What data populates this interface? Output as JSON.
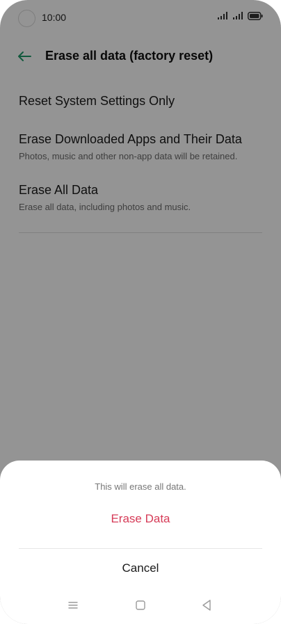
{
  "status_bar": {
    "time": "10:00",
    "icons": [
      "signal-icon",
      "signal-icon",
      "battery-icon"
    ]
  },
  "app_bar": {
    "back_icon": "back-arrow-icon",
    "title": "Erase all data (factory reset)",
    "accent_color": "#1f9a6a"
  },
  "options": [
    {
      "title": "Reset System Settings Only",
      "subtitle": ""
    },
    {
      "title": "Erase Downloaded Apps and Their Data",
      "subtitle": "Photos, music and other non-app data will be retained."
    },
    {
      "title": "Erase All Data",
      "subtitle": "Erase all data, including photos and music."
    }
  ],
  "sheet": {
    "message": "This will erase all data.",
    "confirm_label": "Erase Data",
    "cancel_label": "Cancel",
    "confirm_color": "#d63b57"
  },
  "nav_bar": {
    "icons": [
      "menu-icon",
      "home-icon",
      "back-icon"
    ]
  }
}
